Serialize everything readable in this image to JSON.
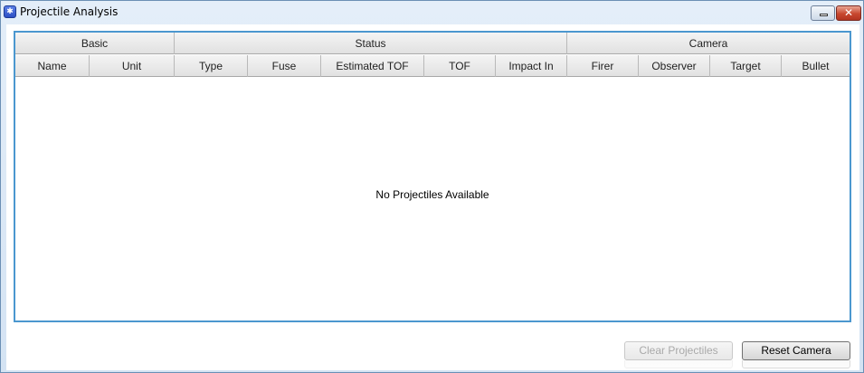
{
  "window": {
    "title": "Projectile Analysis",
    "icon": "app-icon",
    "close_glyph": "✕"
  },
  "table": {
    "groups": [
      {
        "label": "Basic"
      },
      {
        "label": "Status"
      },
      {
        "label": "Camera"
      }
    ],
    "columns": [
      {
        "label": "Name"
      },
      {
        "label": "Unit"
      },
      {
        "label": "Type"
      },
      {
        "label": "Fuse"
      },
      {
        "label": "Estimated TOF"
      },
      {
        "label": "TOF"
      },
      {
        "label": "Impact In"
      },
      {
        "label": "Firer"
      },
      {
        "label": "Observer"
      },
      {
        "label": "Target"
      },
      {
        "label": "Bullet"
      }
    ],
    "empty_message": "No Projectiles Available"
  },
  "buttons": {
    "clear": {
      "label": "Clear Projectiles",
      "enabled": false
    },
    "reset": {
      "label": "Reset Camera",
      "enabled": true
    }
  }
}
